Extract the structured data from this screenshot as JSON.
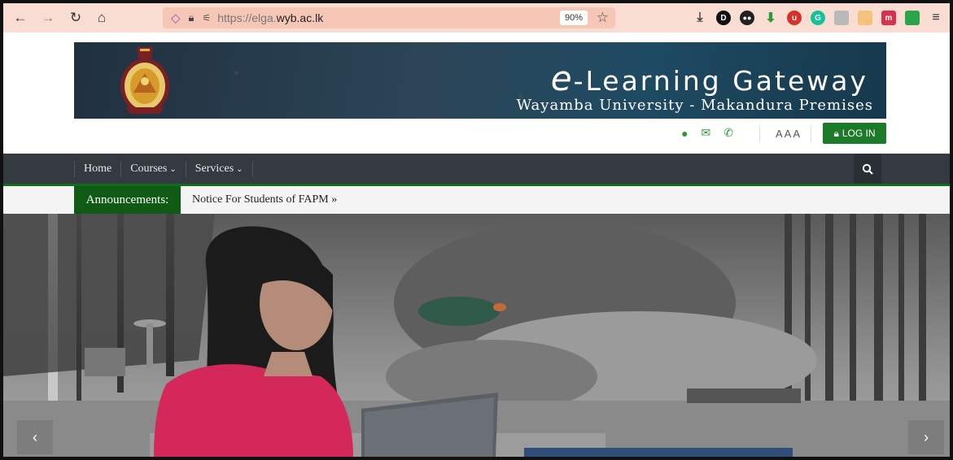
{
  "browser": {
    "url_prefix": "https://elga.",
    "url_domain": "wyb.ac.lk",
    "zoom": "90%"
  },
  "header": {
    "title_initial": "e",
    "title_rest": "-Learning Gateway",
    "subtitle": "Wayamba University - Makandura Premises",
    "font_size_label": "AAA",
    "login_label": "LOG IN"
  },
  "nav": {
    "items": [
      {
        "label": "Home",
        "has_caret": false
      },
      {
        "label": "Courses",
        "has_caret": true
      },
      {
        "label": "Services",
        "has_caret": true
      }
    ],
    "caret": "⌄"
  },
  "announcements": {
    "label": "Announcements:",
    "text": "Notice For Students of FAPM »"
  },
  "carousel": {
    "prev": "‹",
    "next": "›"
  },
  "colors": {
    "accent_green": "#1b7a28",
    "nav_dark": "#343a40",
    "announcement_green": "#0f5a14"
  }
}
